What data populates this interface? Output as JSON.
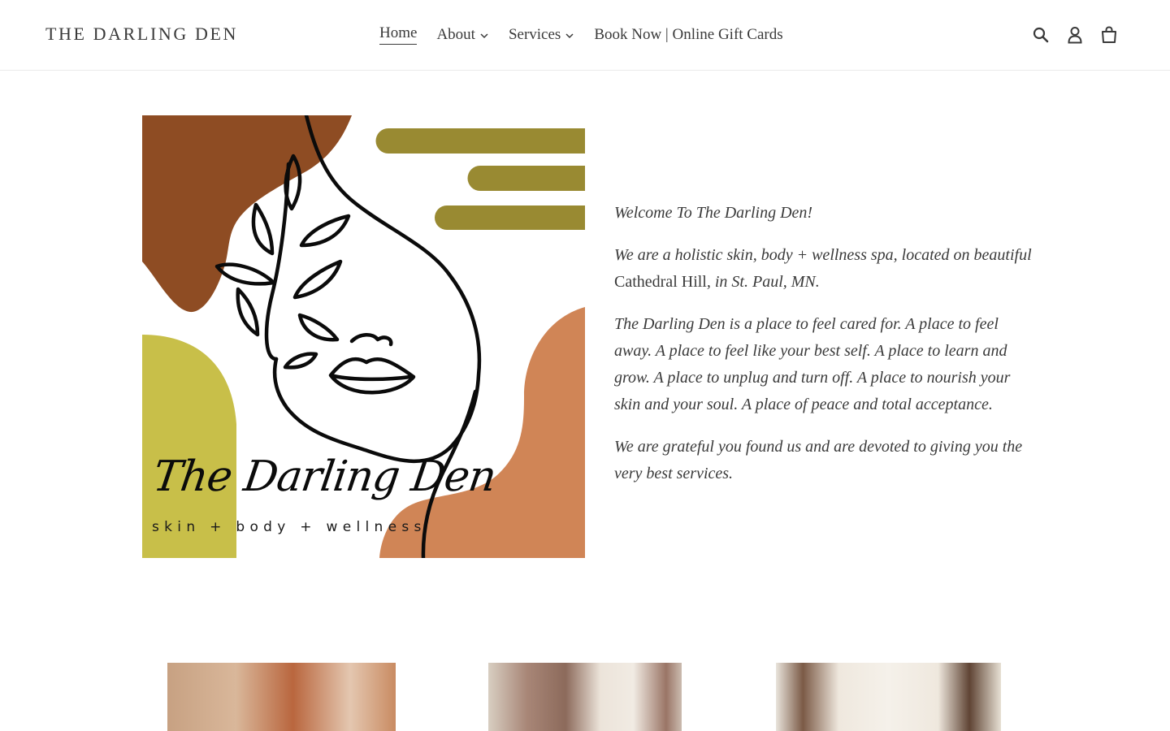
{
  "header": {
    "logo": "THE DARLING DEN",
    "nav": [
      {
        "label": "Home",
        "active": true,
        "dropdown": false
      },
      {
        "label": "About",
        "active": false,
        "dropdown": true
      },
      {
        "label": "Services",
        "active": false,
        "dropdown": true
      },
      {
        "label": "Book Now | Online Gift Cards",
        "active": false,
        "dropdown": false
      }
    ],
    "icons": [
      "search-icon",
      "account-icon",
      "cart-icon"
    ]
  },
  "hero": {
    "art": {
      "script": "The Darling Den",
      "tagline": "skin + body + wellness",
      "colors": {
        "rust": "#8e4c23",
        "olive": "#998a32",
        "chartreuse": "#c8bf49",
        "terracotta": "#d08556",
        "line": "#0b0b0b"
      }
    },
    "intro": {
      "p1": "Welcome To The Darling Den!",
      "p2_a": "We are a holistic skin, body + wellness spa, located on beautiful ",
      "p2_b": "Cathedral Hill",
      "p2_c": ", in St. Paul, MN.",
      "p3": "The Darling Den is a place to feel cared for. A place to feel away. A place to feel like your best self. A place to learn and grow. A place to unplug and turn off. A place to nourish your skin and your soul. A place of peace and total acceptance.",
      "p4": "We are grateful you found us and are devoted to giving you the very best services."
    }
  },
  "gallery": [
    "spa-plant-photo",
    "spa-room-photo",
    "spa-hallway-photo"
  ]
}
